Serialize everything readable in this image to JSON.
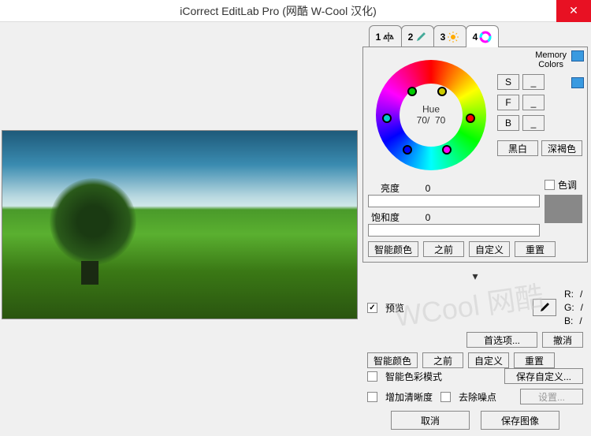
{
  "window": {
    "title": "iCorrect EditLab Pro  (网酷 W-Cool 汉化)"
  },
  "tabs": [
    {
      "num": "1",
      "icon": "balance-icon"
    },
    {
      "num": "2",
      "icon": "eyedropper-icon"
    },
    {
      "num": "3",
      "icon": "brightness-icon"
    },
    {
      "num": "4",
      "icon": "color-wheel-icon"
    }
  ],
  "memory_colors_label": "Memory\nColors",
  "hue": {
    "label": "Hue",
    "left": "70/",
    "right": "70"
  },
  "sfb": {
    "s": "S",
    "f": "F",
    "b": "B",
    "dash": "_"
  },
  "bw_btn": "黑白",
  "sepia_btn": "深褐色",
  "brightness": {
    "label": "亮度",
    "value": "0"
  },
  "saturation": {
    "label": "饱和度",
    "value": "0"
  },
  "tint_label": "色调",
  "panel_buttons": {
    "smart": "智能颜色",
    "before": "之前",
    "custom": "自定义",
    "reset": "重置"
  },
  "preview_label": "预览",
  "rgb": {
    "r": "R:",
    "g": "G:",
    "b": "B:",
    "slash": "/"
  },
  "prefs_btn": "首选项...",
  "undo_btn": "撤消",
  "row2": {
    "smart": "智能颜色",
    "before": "之前",
    "custom": "自定义",
    "reset": "重置"
  },
  "smart_mode_label": "智能色彩模式",
  "save_custom_btn": "保存自定义...",
  "sharpen_label": "增加清晰度",
  "denoise_label": "去除噪点",
  "settings_btn": "设置...",
  "cancel_btn": "取消",
  "save_image_btn": "保存图像"
}
